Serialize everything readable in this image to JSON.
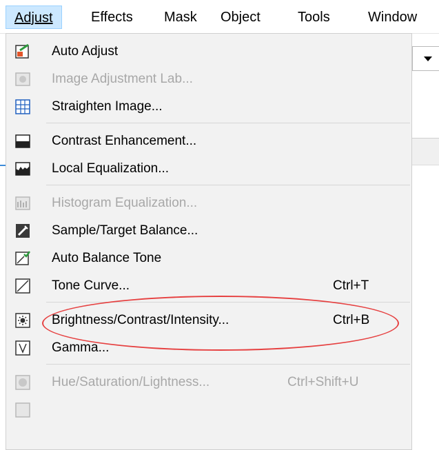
{
  "menubar": {
    "items": [
      {
        "label": "Adjust",
        "active": true
      },
      {
        "label": "Effects"
      },
      {
        "label": "Mask"
      },
      {
        "label": "Object"
      },
      {
        "label": "Tools"
      },
      {
        "label": "Window"
      }
    ]
  },
  "menu": {
    "items": [
      {
        "label": "Auto Adjust",
        "icon": "auto-adjust-icon",
        "enabled": true
      },
      {
        "label": "Image Adjustment Lab...",
        "icon": "image-adjustment-lab-icon",
        "enabled": false
      },
      {
        "label": "Straighten Image...",
        "icon": "straighten-image-icon",
        "enabled": true
      },
      {
        "label": "Contrast Enhancement...",
        "icon": "contrast-enhancement-icon",
        "enabled": true
      },
      {
        "label": "Local Equalization...",
        "icon": "local-equalization-icon",
        "enabled": true
      },
      {
        "label": "Histogram Equalization...",
        "icon": "histogram-equalization-icon",
        "enabled": false
      },
      {
        "label": "Sample/Target Balance...",
        "icon": "sample-target-balance-icon",
        "enabled": true
      },
      {
        "label": "Auto Balance Tone",
        "icon": "auto-balance-tone-icon",
        "enabled": true
      },
      {
        "label": "Tone Curve...",
        "shortcut": "Ctrl+T",
        "icon": "tone-curve-icon",
        "enabled": true
      },
      {
        "label": "Brightness/Contrast/Intensity...",
        "shortcut": "Ctrl+B",
        "icon": "brightness-contrast-icon",
        "enabled": true,
        "highlighted": true
      },
      {
        "label": "Gamma...",
        "icon": "gamma-icon",
        "enabled": true
      },
      {
        "label": "Hue/Saturation/Lightness...",
        "shortcut": "Ctrl+Shift+U",
        "icon": "hue-saturation-icon",
        "enabled": false
      }
    ]
  },
  "colors": {
    "active_menubar_bg": "#cce8ff",
    "menu_bg": "#f2f2f2",
    "disabled_text": "#a8a8a8",
    "annotation": "#e64040"
  }
}
